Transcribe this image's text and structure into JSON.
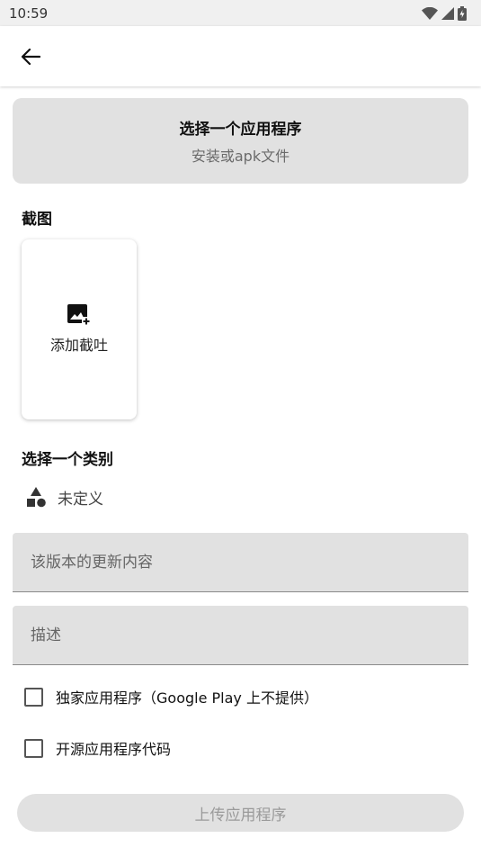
{
  "status_bar": {
    "time": "10:59",
    "icons": [
      "wifi-icon",
      "signal-icon",
      "battery-icon"
    ]
  },
  "app_bar": {
    "back_icon": "arrow-left-icon"
  },
  "select_app": {
    "title": "选择一个应用程序",
    "subtitle": "安装或apk文件"
  },
  "screenshots": {
    "section_title": "截图",
    "add_label": "添加截吐",
    "add_icon": "add-photo-icon"
  },
  "category": {
    "section_title": "选择一个类别",
    "value": "未定义",
    "icon": "category-shapes-icon"
  },
  "fields": {
    "update_content_placeholder": "该版本的更新内容",
    "description_placeholder": "描述"
  },
  "checkboxes": {
    "exclusive": {
      "label": "独家应用程序（Google Play 上不提供）",
      "checked": false
    },
    "open_source": {
      "label": "开源应用程序代码",
      "checked": false
    }
  },
  "upload_button": {
    "label": "上传应用程序",
    "enabled": false
  },
  "colors": {
    "surface": "#e1e1e1",
    "status_bar": "#f0f0f0",
    "disabled_text": "#9a9a9a"
  }
}
